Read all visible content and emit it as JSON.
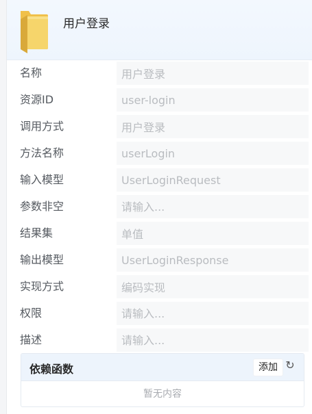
{
  "header": {
    "title": "用户登录",
    "icon": "folder-icon"
  },
  "form": {
    "fields": [
      {
        "label": "名称",
        "value": "用户登录",
        "placeholder": ""
      },
      {
        "label": "资源ID",
        "value": "user-login",
        "placeholder": ""
      },
      {
        "label": "调用方式",
        "value": "用户登录",
        "placeholder": ""
      },
      {
        "label": "方法名称",
        "value": "userLogin",
        "placeholder": ""
      },
      {
        "label": "输入模型",
        "value": "UserLoginRequest",
        "placeholder": ""
      },
      {
        "label": "参数非空",
        "value": "",
        "placeholder": "请输入..."
      },
      {
        "label": "结果集",
        "value": "单值",
        "placeholder": ""
      },
      {
        "label": "输出模型",
        "value": "UserLoginResponse",
        "placeholder": ""
      },
      {
        "label": "实现方式",
        "value": "编码实现",
        "placeholder": ""
      },
      {
        "label": "权限",
        "value": "",
        "placeholder": "请输入..."
      },
      {
        "label": "描述",
        "value": "",
        "placeholder": "请输入..."
      }
    ]
  },
  "dependencies": {
    "title": "依赖函数",
    "add_label": "添加",
    "refresh_icon": "refresh-icon",
    "empty_text": "暂无内容"
  },
  "colors": {
    "header_bg": "#eef5fd",
    "input_bg": "#f7f8f9",
    "folder_yellow": "#f6cf5a"
  }
}
